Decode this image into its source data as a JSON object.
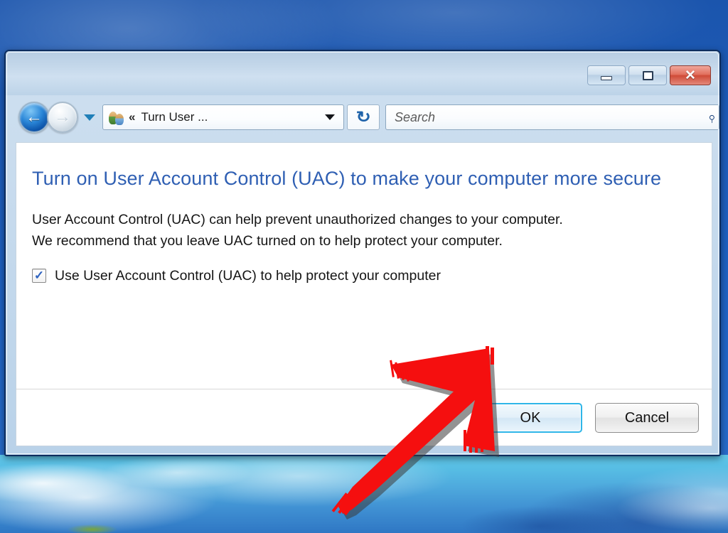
{
  "window": {
    "title": "",
    "controls": {
      "minimize_label": "–",
      "maximize_label": "□",
      "close_label": "✕",
      "minimize_name": "Minimize",
      "maximize_name": "Maximize",
      "close_name": "Close"
    }
  },
  "navigation": {
    "back_glyph": "←",
    "forward_glyph": "→",
    "history_glyph": "▼",
    "address": {
      "icon": "user-accounts-icon",
      "chevron": "«",
      "text": "Turn User ...",
      "dropdown_glyph": "▼"
    },
    "refresh_glyph": "↻",
    "search": {
      "placeholder": "Search",
      "icon_glyph": "⌕"
    }
  },
  "content": {
    "heading": "Turn on User Account Control (UAC) to make your computer more secure",
    "paragraph_line1": "User Account Control (UAC) can help prevent unauthorized changes to your computer.",
    "paragraph_line2": "We recommend that you leave UAC turned on to help protect your computer.",
    "checkbox": {
      "label": "Use User Account Control (UAC) to help protect your computer",
      "checked": true,
      "tick_glyph": "✓"
    }
  },
  "buttons": {
    "ok_label": "OK",
    "cancel_label": "Cancel"
  },
  "annotation": {
    "type": "arrow",
    "color": "#f50f0f",
    "points_to": "ok-button"
  },
  "colors": {
    "heading_blue": "#2f5fb3",
    "ok_focus_border": "#2fb6e8",
    "close_button_red": "#cf4b38",
    "annotation_red": "#f50f0f",
    "desktop_blue": "#1d5cba"
  }
}
